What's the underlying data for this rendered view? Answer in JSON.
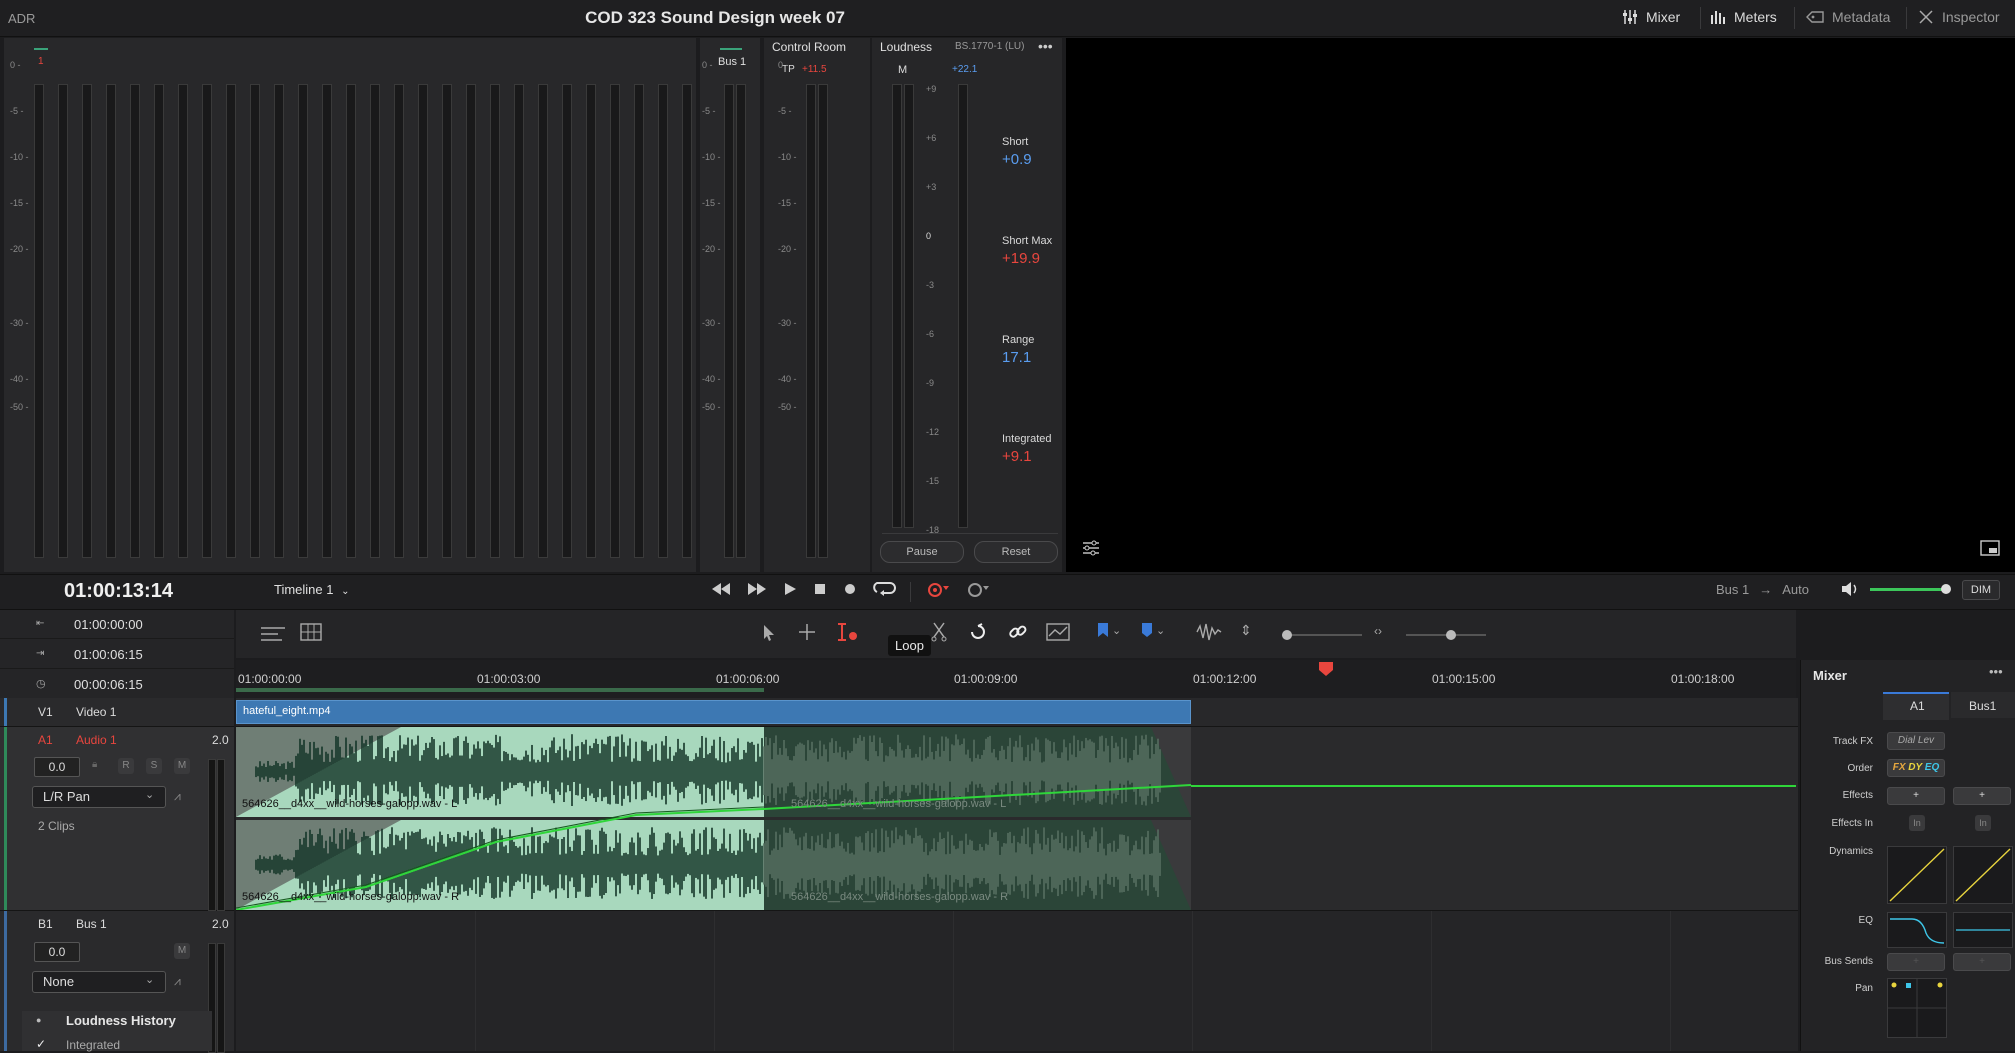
{
  "topbar": {
    "left_label": "ADR",
    "title": "COD 323 Sound Design week 07",
    "buttons": [
      {
        "label": "Mixer",
        "icon": "sliders-icon"
      },
      {
        "label": "Meters",
        "icon": "meters-icon"
      },
      {
        "label": "Metadata",
        "icon": "tag-icon"
      },
      {
        "label": "Inspector",
        "icon": "inspector-icon"
      }
    ]
  },
  "meters": {
    "channel_label": "1",
    "scale": [
      "0",
      "-5",
      "-10",
      "-15",
      "-20",
      "-30",
      "-40",
      "-50"
    ]
  },
  "bus_meter": {
    "label": "Bus 1"
  },
  "control_room": {
    "header": "Control Room",
    "tp_label": "TP",
    "tp_value": "+11.5"
  },
  "loudness": {
    "header": "Loudness",
    "standard": "BS.1770-1 (LU)",
    "m_label": "M",
    "m_value": "+22.1",
    "scale": [
      "+9",
      "+6",
      "+3",
      "0",
      "-3",
      "-6",
      "-9",
      "-12",
      "-15",
      "-18"
    ],
    "short_label": "Short",
    "short_value": "+0.9",
    "short_max_label": "Short Max",
    "short_max_value": "+19.9",
    "range_label": "Range",
    "range_value": "17.1",
    "integrated_label": "Integrated",
    "integrated_value": "+9.1",
    "pause_label": "Pause",
    "reset_label": "Reset"
  },
  "transport": {
    "timecode": "01:00:13:14",
    "timeline_name": "Timeline 1",
    "bus_label": "Bus 1",
    "auto_label": "Auto",
    "dim_label": "DIM",
    "volume": 0.95
  },
  "timecodes": {
    "in": "01:00:00:00",
    "out": "01:00:06:15",
    "duration": "00:00:06:15"
  },
  "toolbar": {
    "tooltip": "Loop"
  },
  "ruler": {
    "labels": [
      "01:00:00:00",
      "01:00:03:00",
      "01:00:06:00",
      "01:00:09:00",
      "01:00:12:00",
      "01:00:15:00",
      "01:00:18:00"
    ]
  },
  "tracks": {
    "v1": {
      "id": "V1",
      "name": "Video 1",
      "clip": "hateful_eight.mp4"
    },
    "a1": {
      "id": "A1",
      "name": "Audio 1",
      "format": "2.0",
      "level": "0.0",
      "r": "R",
      "s": "S",
      "m": "M",
      "pan": "L/R Pan",
      "clips": "2 Clips",
      "clip_l": "564626__d4xx__wild-horses-galopp.wav - L",
      "clip_r": "564626__d4xx__wild-horses-galopp.wav - R"
    },
    "b1": {
      "id": "B1",
      "name": "Bus 1",
      "format": "2.0",
      "level": "0.0",
      "m": "M",
      "pan": "None"
    }
  },
  "loudness_history": {
    "title": "Loudness History",
    "item": "Integrated"
  },
  "mixer": {
    "title": "Mixer",
    "columns": [
      "A1",
      "Bus1"
    ],
    "rows": [
      "Track FX",
      "Order",
      "Effects",
      "Effects In",
      "Dynamics",
      "EQ",
      "Bus Sends",
      "Pan"
    ],
    "track_fx": "Dial Lev",
    "order_fx": "FX",
    "order_dy": "DY",
    "order_eq": "EQ",
    "effects_add": "+",
    "effects_in": "In"
  },
  "colors": {
    "accent_blue": "#5a9df0",
    "red": "#e8463e",
    "clip_green": "#a8d8bd",
    "video_blue": "#3d78b3"
  }
}
